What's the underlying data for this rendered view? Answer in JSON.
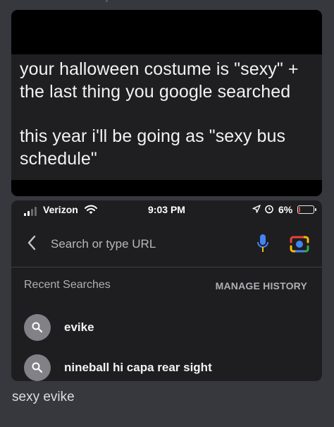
{
  "meme": {
    "line1": "your halloween costume is \"sexy\" +",
    "line2": "the last thing you google searched",
    "line3": "this year i'll be going as \"sexy bus",
    "line4": "schedule\""
  },
  "status_bar": {
    "carrier": "Verizon",
    "time": "9:03 PM",
    "battery_text": "6%",
    "battery_level": 0.06,
    "signal_bars_active": 2,
    "signal_bars_total": 4
  },
  "search": {
    "placeholder": "Search or type URL"
  },
  "recent": {
    "title": "Recent Searches",
    "manage": "MANAGE HISTORY",
    "items": [
      {
        "label": "evike"
      },
      {
        "label": "nineball hi capa rear sight"
      }
    ]
  },
  "caption": "sexy evike",
  "colors": {
    "page_bg": "#36383e",
    "card_bg": "#1e1e20",
    "mic_blue": "#4285f4",
    "mic_orange": "#fbbc04",
    "battery_red": "#e0453a"
  },
  "icons": [
    "signal-icon",
    "wifi-icon",
    "location-icon",
    "alarm-icon",
    "battery-icon",
    "back-chevron-icon",
    "microphone-icon",
    "google-lens-icon",
    "search-icon"
  ]
}
